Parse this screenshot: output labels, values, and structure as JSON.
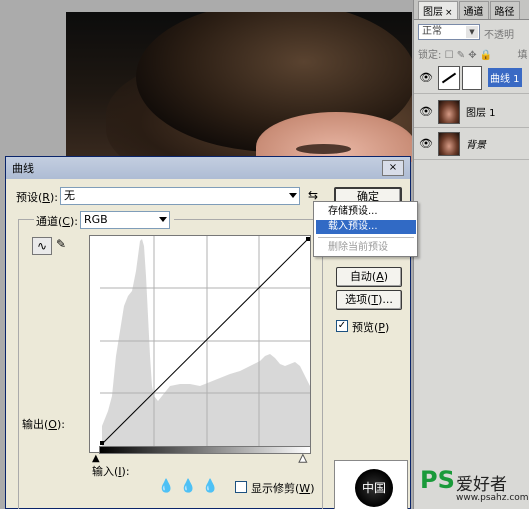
{
  "layers_panel": {
    "tabs": [
      {
        "label": "图层",
        "close": "×"
      },
      {
        "label": "通道"
      },
      {
        "label": "路径"
      }
    ],
    "blend_mode": "正常",
    "opacity_label": "不透明",
    "lock_label": "锁定:",
    "lock_icons": "☐ ✎ ✥ 🔒",
    "fill_label": "填",
    "layers": [
      {
        "name": "曲线 1",
        "selected": true
      },
      {
        "name": "图层 1"
      },
      {
        "name": "背景",
        "italic": true
      }
    ]
  },
  "dialog": {
    "title": "曲线",
    "close_label": "×",
    "preset_label": "预设(",
    "preset_key": "R",
    "preset_suffix": "):",
    "preset_value": "无",
    "preset_menu_icon": "⇆",
    "channel_label": "通道(",
    "channel_key": "C",
    "channel_suffix": "):",
    "channel_value": "RGB",
    "output_label": "输出(",
    "output_key": "O",
    "output_suffix": "):",
    "input_label": "输入(",
    "input_key": "I",
    "input_suffix": "):",
    "buttons": {
      "ok": "确定",
      "auto": "自动(",
      "auto_key": "A",
      "auto_suffix": ")",
      "options": "选项(",
      "options_key": "T",
      "options_suffix": ")..."
    },
    "preview_label": "预览(",
    "preview_key": "P",
    "preview_suffix": ")",
    "preview_checked": true,
    "show_clipping_label": "显示修剪(",
    "show_clipping_key": "W",
    "show_clipping_suffix": ")",
    "show_clipping_checked": false,
    "seal_text": "中国"
  },
  "preset_menu": {
    "items": [
      {
        "label": "存储预设..."
      },
      {
        "label": "载入预设...",
        "highlighted": true
      },
      {
        "label": "删除当前预设",
        "disabled": true
      }
    ]
  },
  "watermark": {
    "brand": "PS",
    "name": "爱好者",
    "url": "www.psahz.com"
  }
}
